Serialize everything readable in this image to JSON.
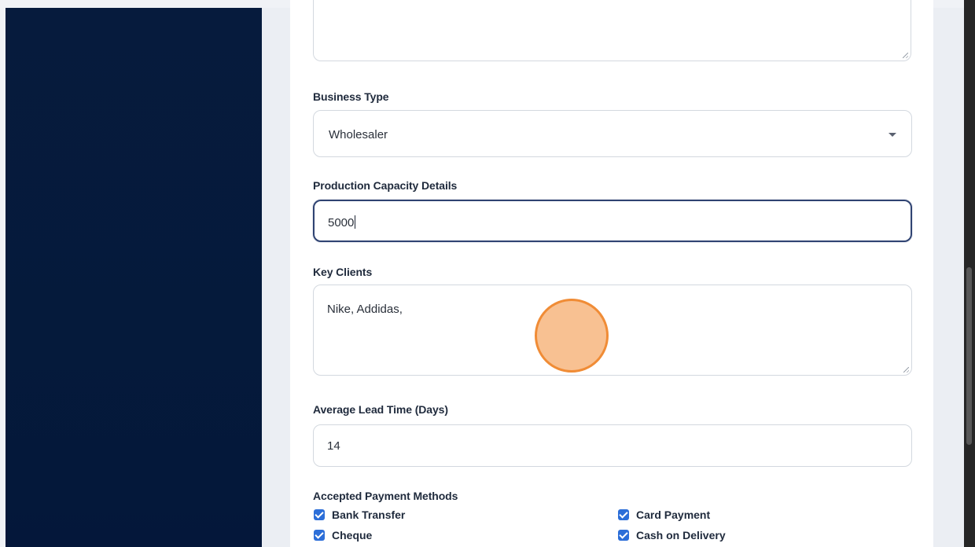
{
  "form": {
    "business_type": {
      "label": "Business Type",
      "value": "Wholesaler"
    },
    "production_capacity": {
      "label": "Production Capacity Details",
      "value": "5000"
    },
    "key_clients": {
      "label": "Key Clients",
      "value": "Nike, Addidas,"
    },
    "lead_time": {
      "label": "Average Lead Time (Days)",
      "value": "14"
    },
    "payment_methods": {
      "label": "Accepted Payment Methods",
      "options": [
        {
          "label": "Bank Transfer",
          "checked": true
        },
        {
          "label": "Card Payment",
          "checked": true
        },
        {
          "label": "Cheque",
          "checked": true
        },
        {
          "label": "Cash on Delivery",
          "checked": true
        }
      ]
    }
  },
  "colors": {
    "sidebar": "#061b3d",
    "focus_border": "#2f4372",
    "checkbox": "#2c6ed8",
    "click_marker": "#f08c36"
  }
}
